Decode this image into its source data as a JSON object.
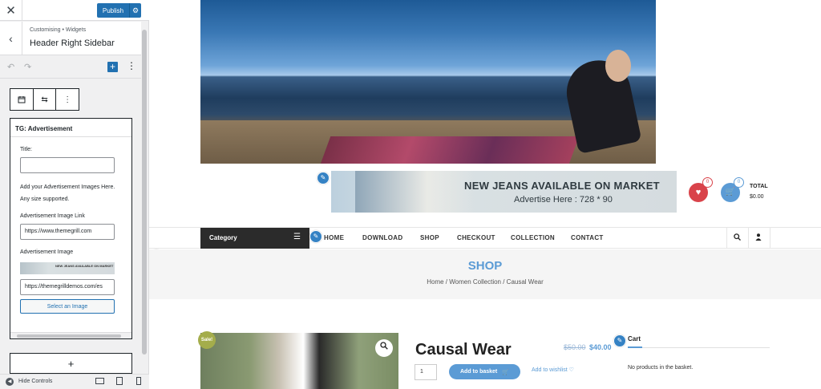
{
  "customizer": {
    "close_icon": "close-icon",
    "publish_label": "Publish",
    "breadcrumb": "Customising • Widgets",
    "section_title": "Header Right Sidebar",
    "widget": {
      "title": "TG: Advertisement",
      "title_label": "Title:",
      "title_value": "",
      "description": "Add your Advertisement Images Here. Any size supported.",
      "link_label": "Advertisement Image Link",
      "link_value": "https://www.themegrill.com",
      "image_label": "Advertisement Image",
      "image_thumb_text": "NEW JEANS AVAILABLE ON MARKET",
      "image_url_value": "https://themegrilldemos.com/es",
      "select_image_label": "Select an Image"
    },
    "add_block_label": "+",
    "hide_controls_label": "Hide Controls"
  },
  "site": {
    "ad": {
      "line1": "NEW JEANS AVAILABLE ON MARKET",
      "line2": "Advertise Here : 728 * 90"
    },
    "wishlist_count": "0",
    "cart_count": "0",
    "total_label": "TOTAL",
    "total_value": "$0.00",
    "category_label": "Category",
    "nav": [
      "HOME",
      "DOWNLOAD",
      "SHOP",
      "CHECKOUT",
      "COLLECTION",
      "CONTACT"
    ],
    "shop_title": "SHOP",
    "breadcrumb": "Home / Women Collection / Causal Wear",
    "sale_badge": "Sale!",
    "product_title": "Causal Wear",
    "old_price": "$50.00",
    "new_price": "$40.00",
    "quantity": "1",
    "add_to_basket": "Add to basket",
    "add_to_wishlist": "Add to wishlist ♡",
    "cart_widget_title": "Cart",
    "cart_empty": "No products in the basket."
  },
  "colors": {
    "accent": "#5b9bd5",
    "wp_blue": "#2271b1",
    "heart": "#d9434a",
    "sale": "#a4ad4b"
  }
}
